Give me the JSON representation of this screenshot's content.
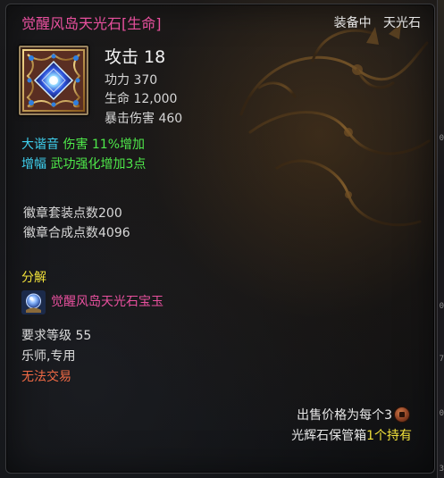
{
  "item": {
    "title": "觉醒风岛天光石[生命]",
    "equip_status": "装备中",
    "equip_slot": "天光石"
  },
  "stats": {
    "main": "攻击 18",
    "lines": [
      "功力 370",
      "生命 12,000",
      "暴击伤害 460"
    ]
  },
  "bonuses": [
    {
      "label": "大谐音",
      "effect": "伤害 11%增加"
    },
    {
      "label": "增幅",
      "effect": "武功强化增加3点"
    }
  ],
  "emblem": {
    "set_points": "徽章套装点数200",
    "synth_points": "徽章合成点数4096"
  },
  "decompose": {
    "header": "分解",
    "result_item": "觉醒风岛天光石宝玉"
  },
  "requirements": {
    "level": "要求等级 55",
    "class": "乐师,专用",
    "trade": "无法交易"
  },
  "sell": {
    "price_text": "出售价格为每个3",
    "storage_prefix": "光辉石保管箱",
    "storage_count": "1个持有"
  },
  "side_strip": {
    "marks": [
      "0",
      "0",
      "7",
      "0",
      "3"
    ]
  },
  "colors": {
    "title_pink": "#e8509e",
    "cyan": "#3fd0ee",
    "green": "#4ee84a",
    "yellow": "#f2e23a",
    "warning_orange": "#f06a45"
  },
  "icons": {
    "item": "gem-crystal-icon",
    "result": "gem-orb-icon",
    "currency": "copper-coin-icon"
  }
}
